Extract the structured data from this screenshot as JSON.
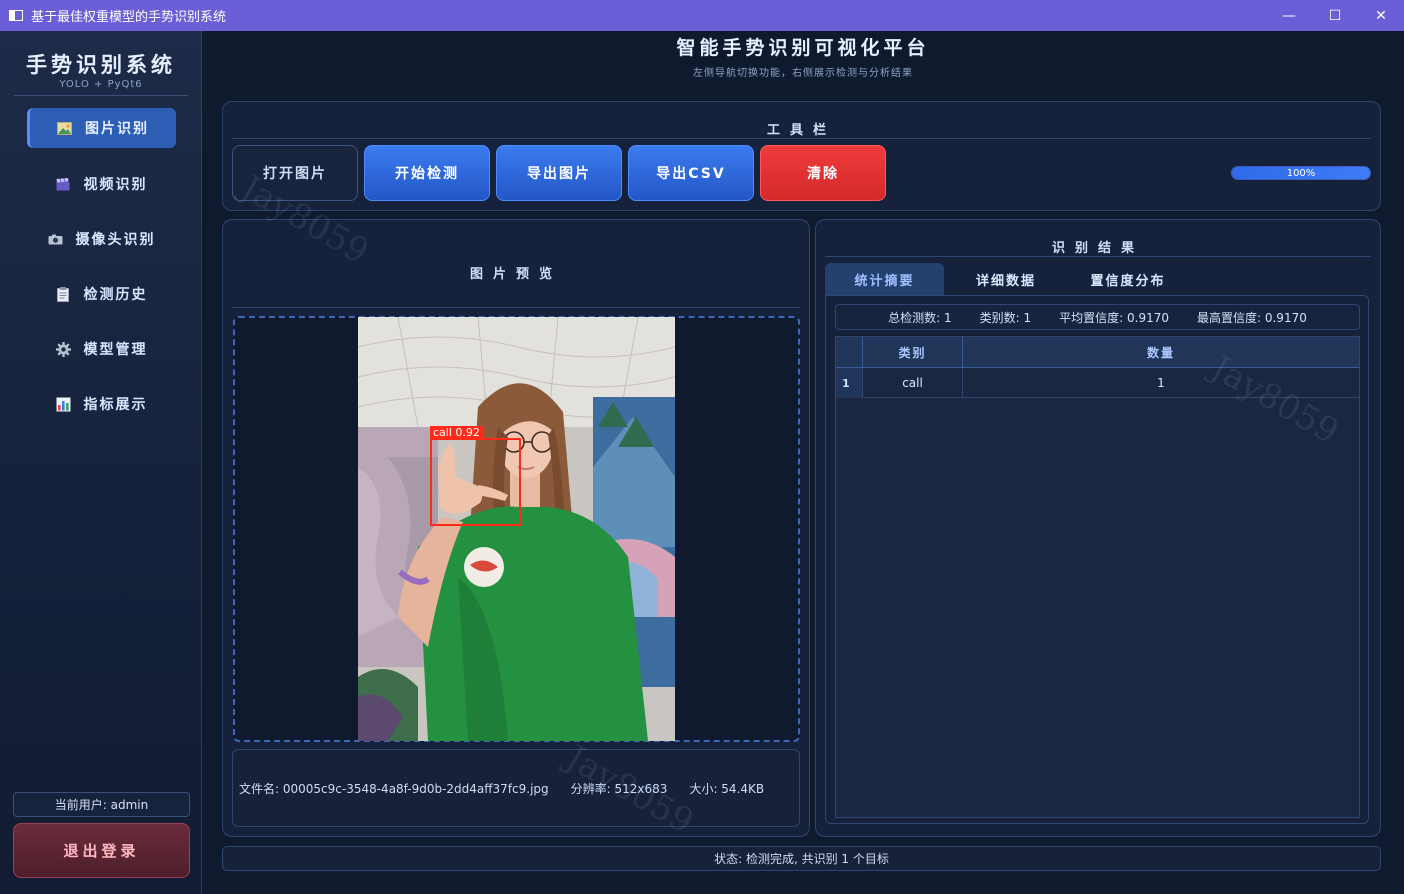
{
  "window": {
    "title": "基于最佳权重模型的手势识别系统",
    "minimize": "—",
    "maximize": "☐",
    "close": "✕"
  },
  "sidebar": {
    "title": "手势识别系统",
    "subtitle": "YOLO + PyQt6",
    "items": [
      {
        "label": "图片识别",
        "icon": "image-icon",
        "active": true
      },
      {
        "label": "视频识别",
        "icon": "clapper-icon",
        "active": false
      },
      {
        "label": "摄像头识别",
        "icon": "camera-icon",
        "active": false
      },
      {
        "label": "检测历史",
        "icon": "notepad-icon",
        "active": false
      },
      {
        "label": "模型管理",
        "icon": "gear-icon",
        "active": false
      },
      {
        "label": "指标展示",
        "icon": "bar-chart-icon",
        "active": false
      }
    ],
    "current_user": "当前用户: admin",
    "logout_label": "退出登录"
  },
  "header": {
    "title": "智能手势识别可视化平台",
    "subtitle": "左侧导航切换功能，右侧展示检测与分析结果"
  },
  "toolbar": {
    "title": "工具栏",
    "buttons": {
      "open": "打开图片",
      "detect": "开始检测",
      "export_image": "导出图片",
      "export_csv": "导出CSV",
      "clear": "清除"
    },
    "progress_value": 1.0,
    "progress_text": "100%"
  },
  "preview": {
    "title": "图片预览",
    "detection_label": "call 0.92",
    "file_name": "文件名: 00005c9c-3548-4a8f-9d0b-2dd4aff37fc9.jpg",
    "resolution": "分辨率: 512x683",
    "size": "大小: 54.4KB"
  },
  "results": {
    "title": "识别结果",
    "tabs": [
      "统计摘要",
      "详细数据",
      "置信度分布"
    ],
    "stats": {
      "total": "总检测数: 1",
      "classes": "类别数: 1",
      "avg_conf": "平均置信度: 0.9170",
      "max_conf": "最高置信度: 0.9170"
    },
    "table": {
      "headers": [
        "类别",
        "数量"
      ],
      "rows": [
        {
          "index": "1",
          "class": "call",
          "count": "1"
        }
      ]
    }
  },
  "status": "状态: 检测完成, 共识别 1 个目标",
  "watermark": "Jay8059"
}
